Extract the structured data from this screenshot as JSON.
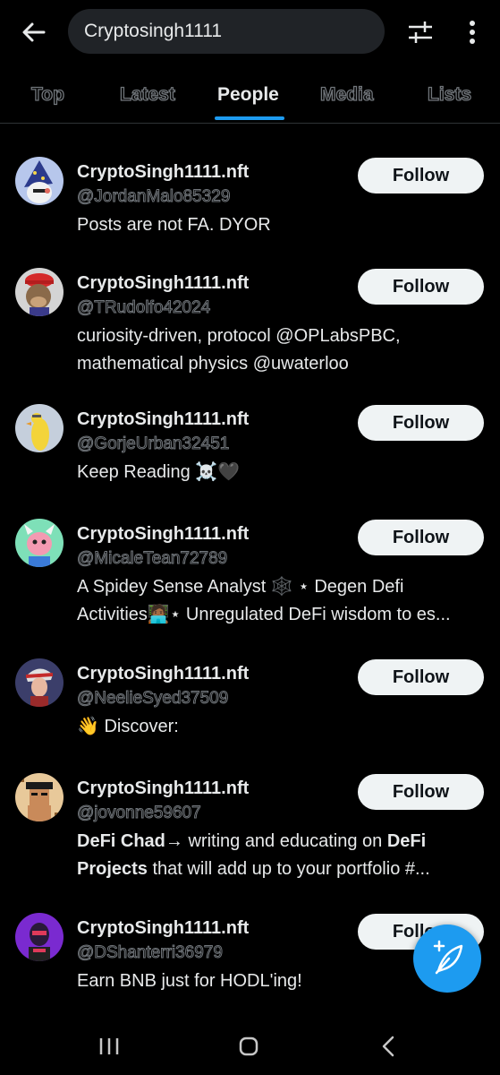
{
  "search": {
    "query": "Cryptosingh1111"
  },
  "tabs": [
    {
      "label": "Top"
    },
    {
      "label": "Latest"
    },
    {
      "label": "People"
    },
    {
      "label": "Media"
    },
    {
      "label": "Lists"
    }
  ],
  "active_tab": "People",
  "people": [
    {
      "name": "CryptoSingh1111.nft",
      "handle": "@JordanMalo85329",
      "bio_line1": "Posts are not FA. DYOR",
      "bio_line2": "",
      "follow_label": "Follow"
    },
    {
      "name": "CryptoSingh1111.nft",
      "handle": "@TRudolfo42024",
      "bio_line1": "curiosity-driven, protocol @OPLabsPBC,",
      "bio_line2": "mathematical physics @uwaterloo",
      "follow_label": "Follow"
    },
    {
      "name": "CryptoSingh1111.nft",
      "handle": "@GorjeUrban32451",
      "bio_line1": "Keep Reading ☠️🖤",
      "bio_line2": "",
      "follow_label": "Follow"
    },
    {
      "name": "CryptoSingh1111.nft",
      "handle": "@MicaleTean72789",
      "bio_line1": "A Spidey Sense Analyst 🕸️ ⋆ Degen Defi",
      "bio_line2": "Activities🧑🏾‍💻⋆ Unregulated DeFi wisdom to es...",
      "follow_label": "Follow"
    },
    {
      "name": "CryptoSingh1111.nft",
      "handle": "@NeelieSyed37509",
      "bio_line1": "👋 Discover:",
      "bio_line2": "",
      "follow_label": "Follow"
    },
    {
      "name": "CryptoSingh1111.nft",
      "handle": "@jovonne59607",
      "bio_b1": "DeFi Chad",
      "bio_t1": "→ writing and educating on ",
      "bio_b2": "DeFi",
      "bio_b3": "Projects",
      "bio_t2": " that will add up to your portfolio #...",
      "follow_label": "Follow"
    },
    {
      "name": "CryptoSingh1111.nft",
      "handle": "@DShanterri36979",
      "bio_line1": "Earn BNB just for HODL'ing!",
      "bio_line2": "",
      "follow_label": "Follow"
    }
  ],
  "icons": {
    "back": "arrow-left-icon",
    "filter": "sliders-icon",
    "more": "more-vertical-icon",
    "compose": "feather-plus-icon",
    "nav_recents": "recents-icon",
    "nav_home": "home-icon",
    "nav_back": "chevron-left-icon"
  },
  "colors": {
    "accent": "#1d9bf0",
    "background": "#000000",
    "secondary_text": "#71767b",
    "follow_button": "#eff3f4"
  }
}
